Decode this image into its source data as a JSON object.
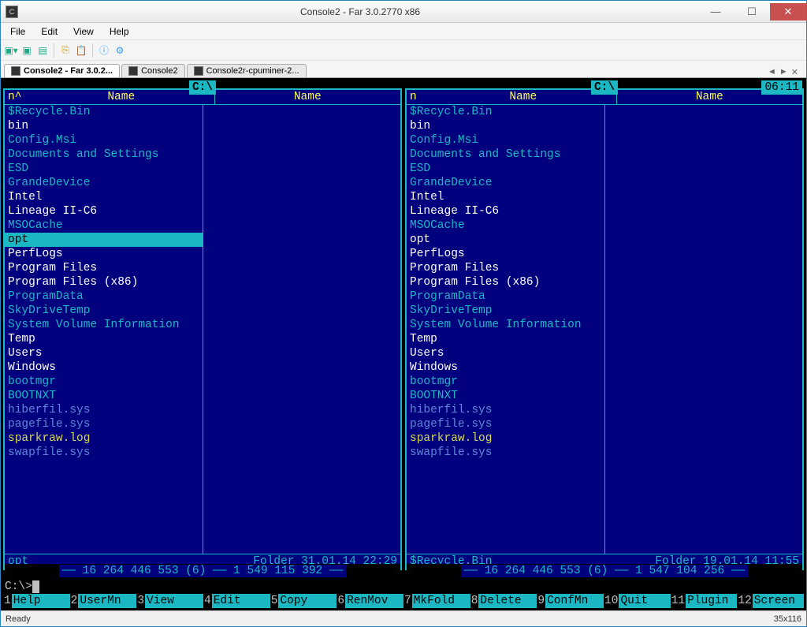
{
  "window": {
    "title": "Console2 - Far 3.0.2770 x86"
  },
  "menu": {
    "file": "File",
    "edit": "Edit",
    "view": "View",
    "help": "Help"
  },
  "tabs": [
    {
      "label": "Console2 - Far 3.0.2...",
      "active": true
    },
    {
      "label": "Console2",
      "active": false
    },
    {
      "label": "Console2r-cpuminer-2...",
      "active": false
    }
  ],
  "clock": "06:11",
  "panels": {
    "left": {
      "path": " C:\\ ",
      "sortcol": "n^",
      "selected": "opt",
      "status_name": "opt",
      "status_info": "Folder 31.01.14 22:29",
      "stats": "—— 16 264 446 553 (6) —— 1 549 115 392 ——"
    },
    "right": {
      "path": " C:\\ ",
      "sortcol": "n",
      "selected": "$Recycle.Bin",
      "status_name": "$Recycle.Bin",
      "status_info": "Folder 19.01.14 11:55",
      "stats": "—— 16 264 446 553 (6) —— 1 547 104 256 ——"
    },
    "header_name": "Name",
    "files": [
      {
        "name": "$Recycle.Bin",
        "cls": "c-hid"
      },
      {
        "name": "bin",
        "cls": "c-dir"
      },
      {
        "name": "Config.Msi",
        "cls": "c-hid"
      },
      {
        "name": "Documents and Settings",
        "cls": "c-hid"
      },
      {
        "name": "ESD",
        "cls": "c-hid"
      },
      {
        "name": "GrandeDevice",
        "cls": "c-hid"
      },
      {
        "name": "Intel",
        "cls": "c-dir"
      },
      {
        "name": "Lineage II-C6",
        "cls": "c-dir"
      },
      {
        "name": "MSOCache",
        "cls": "c-hid"
      },
      {
        "name": "opt",
        "cls": "c-dir"
      },
      {
        "name": "PerfLogs",
        "cls": "c-dir"
      },
      {
        "name": "Program Files",
        "cls": "c-dir"
      },
      {
        "name": "Program Files (x86)",
        "cls": "c-dir"
      },
      {
        "name": "ProgramData",
        "cls": "c-hid"
      },
      {
        "name": "SkyDriveTemp",
        "cls": "c-hid"
      },
      {
        "name": "System Volume Information",
        "cls": "c-hid"
      },
      {
        "name": "Temp",
        "cls": "c-dir"
      },
      {
        "name": "Users",
        "cls": "c-dir"
      },
      {
        "name": "Windows",
        "cls": "c-dir"
      },
      {
        "name": "bootmgr",
        "cls": "c-hid"
      },
      {
        "name": "BOOTNXT",
        "cls": "c-hid"
      },
      {
        "name": "hiberfil.sys",
        "cls": "c-sys"
      },
      {
        "name": "pagefile.sys",
        "cls": "c-sys"
      },
      {
        "name": "sparkraw.log",
        "cls": "c-log"
      },
      {
        "name": "swapfile.sys",
        "cls": "c-sys"
      }
    ]
  },
  "prompt": "C:\\>",
  "fkeys": [
    {
      "n": "1",
      "l": "Help"
    },
    {
      "n": "2",
      "l": "UserMn"
    },
    {
      "n": "3",
      "l": "View"
    },
    {
      "n": "4",
      "l": "Edit"
    },
    {
      "n": "5",
      "l": "Copy"
    },
    {
      "n": "6",
      "l": "RenMov"
    },
    {
      "n": "7",
      "l": "MkFold"
    },
    {
      "n": "8",
      "l": "Delete"
    },
    {
      "n": "9",
      "l": "ConfMn"
    },
    {
      "n": "10",
      "l": "Quit"
    },
    {
      "n": "11",
      "l": "Plugin"
    },
    {
      "n": "12",
      "l": "Screen"
    }
  ],
  "status": {
    "left": "Ready",
    "right": "35x116"
  }
}
